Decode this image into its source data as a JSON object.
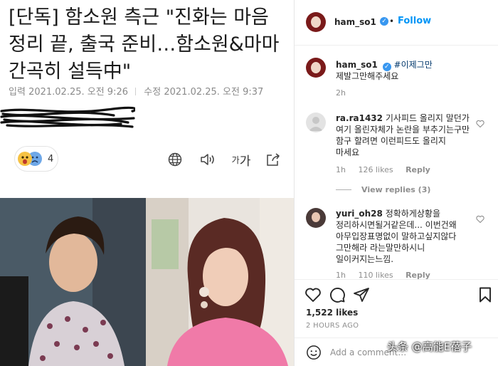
{
  "article": {
    "headline": "[단독] 함소원 측근 \"진화는 마음 정리 끝, 출국 준비…함소원&마마 간곡히 설득中\"",
    "input_label": "입력",
    "input_time": "2021.02.25. 오전 9:26",
    "modified_label": "수정",
    "modified_time": "2021.02.25. 오전 9:37",
    "reaction_count": "4",
    "font_size_label": "가",
    "font_size_label_small": "가",
    "icons": [
      "globe-icon",
      "speaker-icon",
      "font-size-icon",
      "share-icon"
    ]
  },
  "instagram": {
    "header": {
      "username": "ham_so1",
      "dot": "•",
      "follow": "Follow"
    },
    "caption": {
      "username": "ham_so1",
      "hashtag": "#이제그만",
      "text": "제발그만해주세요",
      "time": "2h"
    },
    "comments": [
      {
        "username": "ra.ra1432",
        "text": "기사피드 올리지 말던가 여기 올린자체가 논란을 부추기는구만 함구 할려면 이런피드도 올리지 마세요",
        "time": "1h",
        "likes": "126 likes",
        "reply": "Reply",
        "view_replies": "View replies (3)"
      },
      {
        "username": "yuri_oh28",
        "text": "정확하게상황을 정리하시면될거같은데... 이번건왜 아무입장표명없이 말하고싶지않다 그만해라 라는말만하시니 일이커지는느낌.",
        "time": "1h",
        "likes": "110 likes",
        "reply": "Reply"
      }
    ],
    "likes": "1,522 likes",
    "posted_ago": "2 HOURS AGO",
    "add_comment_placeholder": "Add a comment…",
    "colors": {
      "follow": "#0095f6",
      "verified": "#3897f0",
      "muted": "#8e8e8e"
    }
  },
  "watermark": "头条 @高能E蓓子"
}
